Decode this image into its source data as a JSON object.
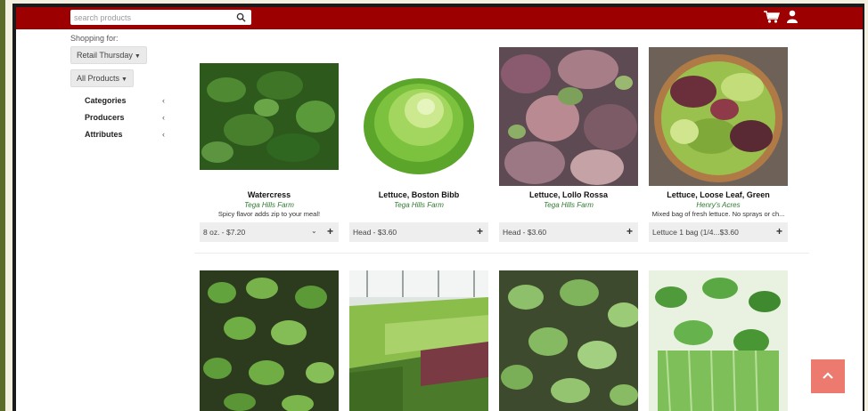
{
  "search": {
    "placeholder": "search products"
  },
  "icons": {
    "search": "search-icon",
    "cart": "cart-icon",
    "user": "user-icon",
    "scroll_top": "chevron-up-icon"
  },
  "colors": {
    "header": "#9c0000",
    "farm_text": "#2f7a2f",
    "scroll_top": "#ec7a6e"
  },
  "sidebar": {
    "shopping_for_label": "Shopping for:",
    "shopping_for_value": "Retail Thursday",
    "all_products_label": "All Products",
    "filters": [
      {
        "label": "Categories"
      },
      {
        "label": "Producers"
      },
      {
        "label": "Attributes"
      }
    ]
  },
  "products": [
    {
      "name": "Watercress",
      "farm": "Tega Hills Farm",
      "description": "Spicy flavor adds zip to your meal!",
      "option": "8 oz. - $7.20",
      "has_dropdown": true
    },
    {
      "name": "Lettuce, Boston Bibb",
      "farm": "Tega Hills Farm",
      "description": "",
      "option": "Head - $3.60",
      "has_dropdown": false
    },
    {
      "name": "Lettuce, Lollo Rossa",
      "farm": "Tega Hills Farm",
      "description": "",
      "option": "Head - $3.60",
      "has_dropdown": false
    },
    {
      "name": "Lettuce, Loose Leaf, Green",
      "farm": "Henry's Acres",
      "description": "Mixed bag of fresh lettuce. No sprays or ch...",
      "option": "Lettuce 1 bag (1/4...$3.60",
      "has_dropdown": false
    }
  ]
}
